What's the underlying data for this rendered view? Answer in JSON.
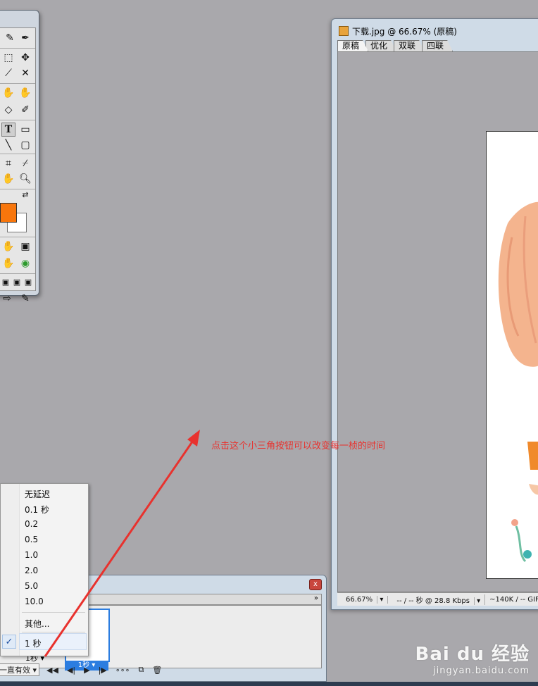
{
  "document": {
    "title": "下载.jpg @ 66.67% (原稿)",
    "tabs": [
      "原稿",
      "优化",
      "双联",
      "四联"
    ],
    "active_tab": 0,
    "status": {
      "zoom": "66.67%",
      "time": "-- / -- 秒 @ 28.8 Kbps",
      "size": "~140K / -- GIF"
    }
  },
  "tools": {
    "type_tool": "T",
    "foreground_color": "#f8760c",
    "background_color": "#ffffff"
  },
  "menu": {
    "items": [
      "无延迟",
      "0.1 秒",
      "0.2",
      "0.5",
      "1.0",
      "2.0",
      "5.0",
      "10.0"
    ],
    "other": "其他...",
    "checked_item": "1 秒",
    "check_mark": "✓"
  },
  "animation": {
    "close_glyph": "x",
    "frame_delay": "1秒",
    "frame_delay_thumb": "1秒",
    "loop": "一直有效",
    "expand_glyph": "»"
  },
  "annotation": {
    "text": "点击这个小三角按钮可以改变每一桢的时间",
    "color": "#e8322e"
  },
  "watermark": {
    "brand": "Bai du 经验",
    "url": "jingyan.baidu.com"
  }
}
